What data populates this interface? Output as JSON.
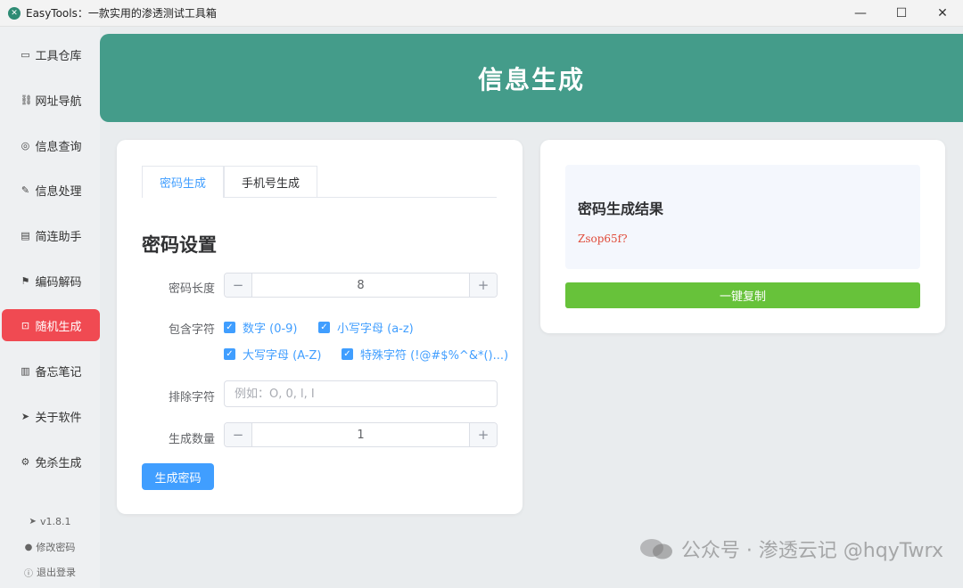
{
  "window": {
    "title": "EasyTools：一款实用的渗透测试工具箱",
    "controls": {
      "minimize": "—",
      "maximize": "☐",
      "close": "✕"
    }
  },
  "sidebar": {
    "items": [
      {
        "label": "工具仓库",
        "icon": "box-icon",
        "glyph": "▭"
      },
      {
        "label": "网址导航",
        "icon": "link-icon",
        "glyph": "⛓"
      },
      {
        "label": "信息查询",
        "icon": "chat-icon",
        "glyph": "◎"
      },
      {
        "label": "信息处理",
        "icon": "edit-icon",
        "glyph": "✎"
      },
      {
        "label": "简连助手",
        "icon": "document-icon",
        "glyph": "▤"
      },
      {
        "label": "编码解码",
        "icon": "flag-icon",
        "glyph": "⚑"
      },
      {
        "label": "随机生成",
        "icon": "cart-icon",
        "glyph": "⊡",
        "active": true
      },
      {
        "label": "备忘笔记",
        "icon": "notebook-icon",
        "glyph": "▥"
      },
      {
        "label": "关于软件",
        "icon": "send-icon",
        "glyph": "➤"
      },
      {
        "label": "免杀生成",
        "icon": "shield-icon",
        "glyph": "⚙"
      }
    ],
    "version": "v1.8.1",
    "change_password": "修改密码",
    "logout": "退出登录"
  },
  "header": {
    "title": "信息生成"
  },
  "tabs": [
    {
      "label": "密码生成",
      "active": true
    },
    {
      "label": "手机号生成",
      "active": false
    }
  ],
  "settings": {
    "title": "密码设置",
    "length_label": "密码长度",
    "length_value": "8",
    "chars_label": "包含字符",
    "options": [
      {
        "label": "数字 (0-9)",
        "checked": true
      },
      {
        "label": "小写字母 (a-z)",
        "checked": true
      },
      {
        "label": "大写字母 (A-Z)",
        "checked": true
      },
      {
        "label": "特殊字符 (!@#$%^&*()...)",
        "checked": true
      }
    ],
    "exclude_label": "排除字符",
    "exclude_placeholder": "例如：O, 0, l, I",
    "count_label": "生成数量",
    "count_value": "1",
    "generate_button": "生成密码"
  },
  "result": {
    "title": "密码生成结果",
    "value": "Zsop65f?",
    "copy_button": "一键复制"
  },
  "watermark": "公众号 · 渗透云记 @hqyTwrx",
  "colors": {
    "banner": "#449c8a",
    "active_nav": "#f04a52",
    "primary": "#409eff",
    "success": "#67c23a",
    "result_text": "#e04b3a"
  }
}
